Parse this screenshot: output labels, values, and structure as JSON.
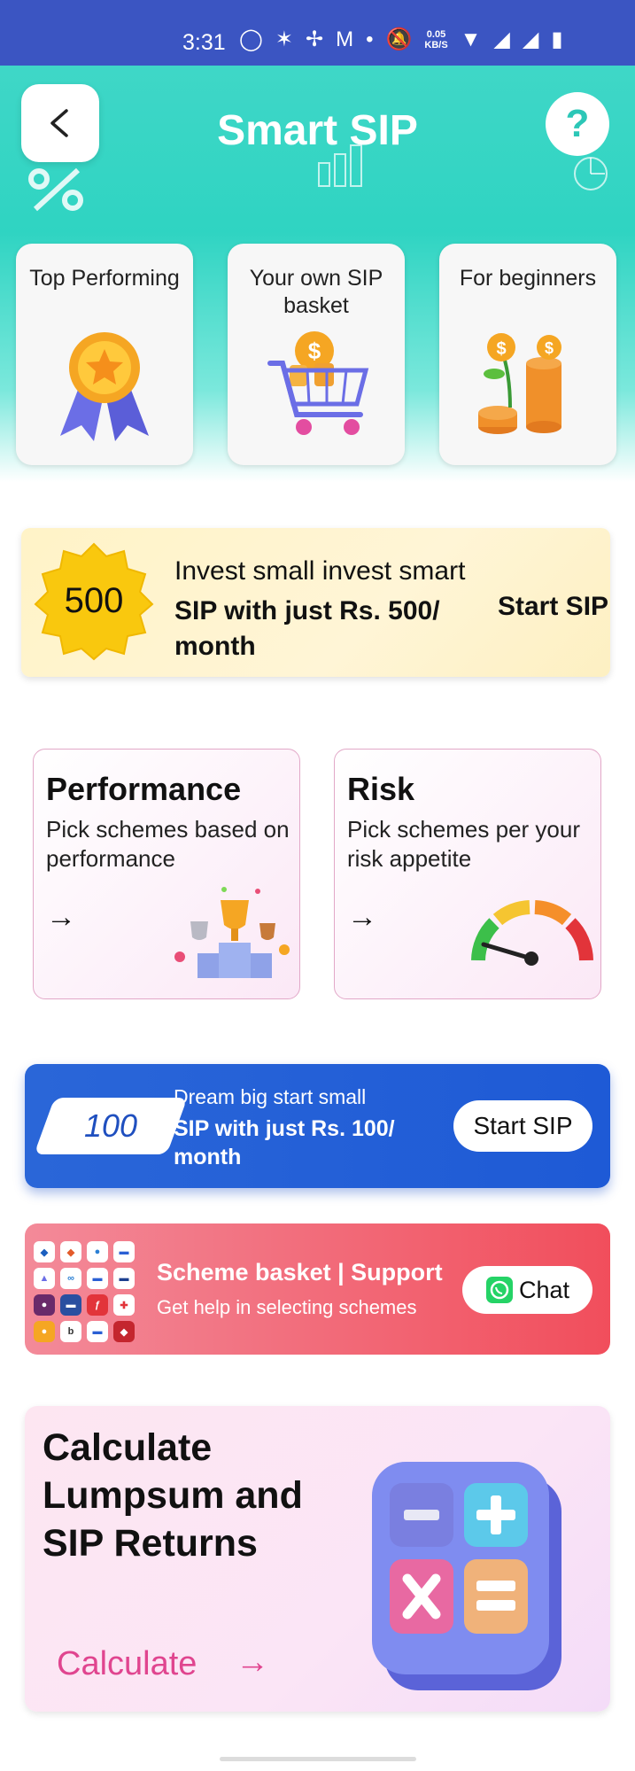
{
  "status_bar": {
    "time": "3:31",
    "network_speed_value": "0.05",
    "network_speed_unit": "KB/S",
    "icons": [
      "whatsapp-icon",
      "bluetooth-icon",
      "fan-icon",
      "gmail-icon",
      "dot-icon",
      "mute-icon",
      "wifi-icon",
      "no-signal-icon",
      "no-signal-icon",
      "battery-charging-icon"
    ]
  },
  "header": {
    "title": "Smart SIP",
    "help_label": "?"
  },
  "categories": [
    {
      "label": "Top Performing",
      "icon": "medal-icon"
    },
    {
      "label": "Your own SIP basket",
      "icon": "shopping-cart-icon"
    },
    {
      "label": "For beginners",
      "icon": "coin-plant-icon"
    }
  ],
  "banner_500": {
    "badge": "500",
    "line1": "Invest small invest smart",
    "line2": "SIP with just Rs. 500/ month",
    "cta": "Start SIP"
  },
  "filters": [
    {
      "title": "Performance",
      "desc": "Pick schemes based on performance",
      "arrow": "→",
      "icon": "trophy-podium-icon"
    },
    {
      "title": "Risk",
      "desc": "Pick schemes per your risk appetite",
      "arrow": "→",
      "icon": "risk-gauge-icon"
    }
  ],
  "banner_100": {
    "badge": "100",
    "line1": "Dream big start small",
    "line2": "SIP with just Rs. 100/ month",
    "cta": "Start SIP"
  },
  "support": {
    "title": "Scheme basket | Support",
    "subtitle": "Get help in selecting schemes",
    "cta": "Chat"
  },
  "calculator": {
    "title": "Calculate Lumpsum and SIP Returns",
    "cta": "Calculate",
    "arrow": "→"
  },
  "colors": {
    "hero": "#35d5c4",
    "status_bar": "#3b55c2",
    "banner_100": "#2262d8",
    "support": "#f14e5c",
    "accent_pink": "#e0458f"
  }
}
